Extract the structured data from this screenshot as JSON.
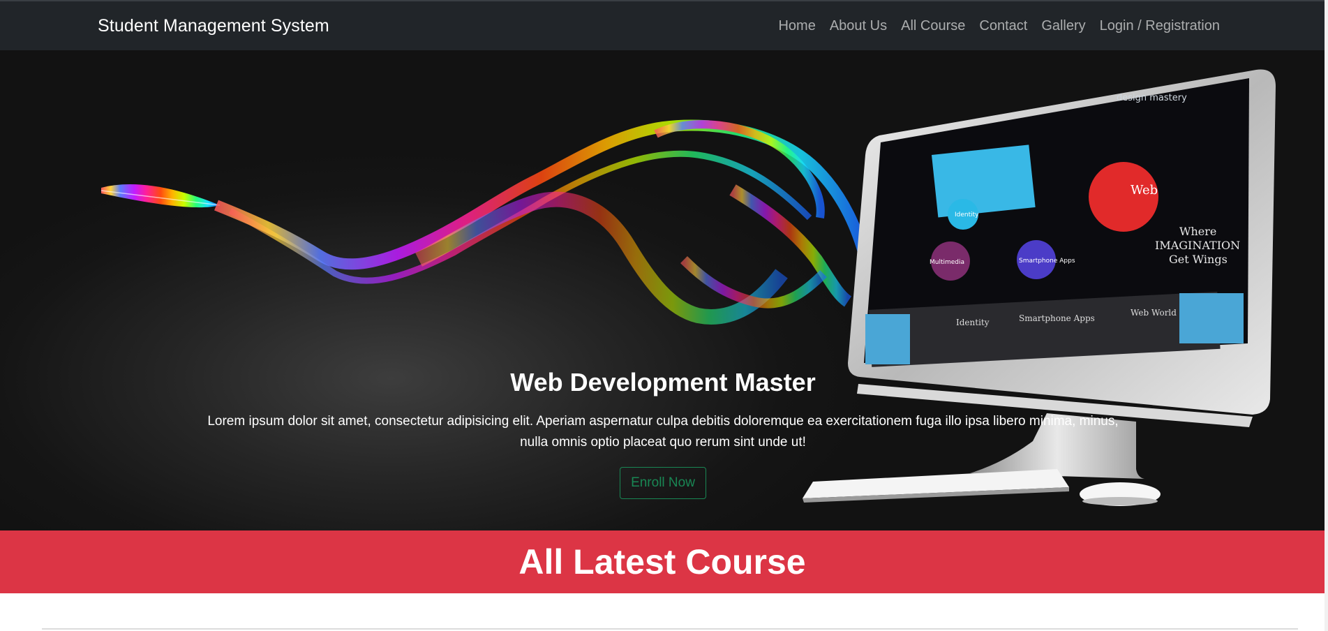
{
  "navbar": {
    "brand": "Student Management System",
    "links": [
      "Home",
      "About Us",
      "All Course",
      "Contact",
      "Gallery",
      "Login / Registration"
    ]
  },
  "hero": {
    "title": "Web Development Master",
    "text": "Lorem ipsum dolor sit amet, consectetur adipisicing elit. Aperiam aspernatur culpa debitis doloremque ea exercitationem fuga illo ipsa libero minima, minus, nulla omnis optio placeat quo rerum sint unde ut!",
    "button": "Enroll Now",
    "screen_text": {
      "brand": "design mastery",
      "tagline_1": "Where",
      "tagline_2": "IMAGINATION",
      "tagline_3": "Get Wings",
      "bubble_web": "Web",
      "bubble_multimedia": "Multimedia",
      "bubble_apps": "Smartphone Apps",
      "bubble_identity": "Identity",
      "panel_1": "Identity",
      "panel_2": "Smartphone Apps",
      "panel_3": "Web World"
    }
  },
  "section": {
    "title": "All Latest Course"
  },
  "colors": {
    "navbar_bg": "#212529",
    "banner_bg": "#dc3545",
    "button_outline": "#198754"
  }
}
